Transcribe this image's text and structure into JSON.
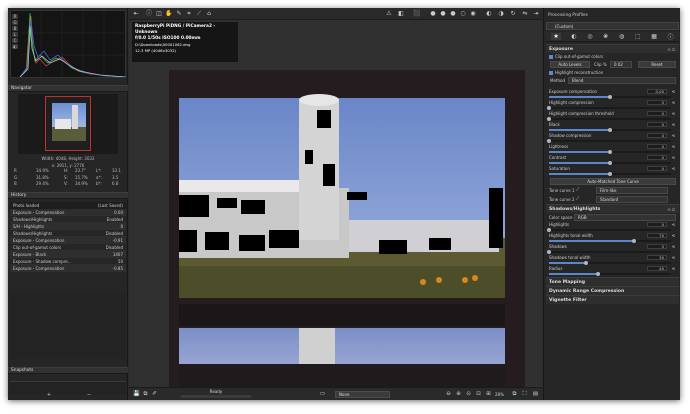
{
  "navigator": {
    "title": "Navigator",
    "size": "Width: 4048, Height: 3032",
    "coords": "x: 2911, y: 2776",
    "readouts": [
      [
        "R",
        "34.9%",
        "H:",
        "23.7°",
        "L*:",
        "33.1"
      ],
      [
        "G",
        "31.8%",
        "S:",
        "15.7%",
        "a*:",
        "3.5"
      ],
      [
        "B",
        "29.4%",
        "V:",
        "34.9%",
        "b*:",
        "6.8"
      ]
    ]
  },
  "history": {
    "title": "History",
    "col1": "Photo loaded",
    "col2": "(Last Saved)",
    "rows": [
      [
        "Exposure - Compensation",
        "0.00"
      ],
      [
        "Shadows/Highlights",
        "Enabled"
      ],
      [
        "S/H - Highlights",
        "0"
      ],
      [
        "Shadows/Highlights",
        "Disabled"
      ],
      [
        "Exposure - Compensation",
        "-0.91"
      ],
      [
        "Clip out-of-gamut colors",
        "Disabled"
      ],
      [
        "Exposure - Black",
        "1407"
      ],
      [
        "Exposure - Shadow compre...",
        "50"
      ],
      [
        "Exposure - Compensation",
        "-0.85"
      ]
    ]
  },
  "snapshots": {
    "title": "Snapshots"
  },
  "image_info": {
    "camera": "RaspberryPi PiDNG / PiCamera2 - Unknown",
    "exposure": "f/0.0  1/50s  ISO100  0.00mm",
    "path": "D:\\Downloads\\00001062.dng",
    "size": "12.3 MP (4048x3032)"
  },
  "status": {
    "ready": "Ready",
    "view_select": "None",
    "zoom": "28%"
  },
  "right": {
    "processing_profiles": "Processing Profiles",
    "profile_value": "(Custom)",
    "exposure": {
      "title": "Exposure",
      "clip": "Clip out-of-gamut colors",
      "auto_levels": "Auto Levels",
      "clip_label": "Clip %",
      "clip_value": "0.02",
      "reset": "Reset",
      "highlight_reconstruction": "Highlight reconstruction",
      "method_label": "Method",
      "method_value": "Blend",
      "sliders": [
        {
          "label": "Exposure compensation",
          "value": "0.00",
          "pos": 0.5
        },
        {
          "label": "Highlight compression",
          "value": "0",
          "pos": 0.0
        },
        {
          "label": "Highlight compression threshold",
          "value": "0",
          "pos": 0.0
        },
        {
          "label": "Black",
          "value": "0",
          "pos": 0.5
        },
        {
          "label": "Shadow compression",
          "value": "0",
          "pos": 0.0
        },
        {
          "label": "Lightness",
          "value": "0",
          "pos": 0.5
        },
        {
          "label": "Contrast",
          "value": "0",
          "pos": 0.5
        },
        {
          "label": "Saturation",
          "value": "0",
          "pos": 0.5
        }
      ],
      "auto_tone": "Auto-Matched Tone Curve",
      "tc1_label": "Tone curve 1",
      "tc1_value": "Film-like",
      "tc2_label": "Tone curve 2",
      "tc2_value": "Standard"
    },
    "shadows": {
      "title": "Shadows/Highlights",
      "color_space_label": "Color space",
      "color_space_value": "RGB",
      "sliders": [
        {
          "label": "Highlights",
          "value": "0",
          "pos": 0.0
        },
        {
          "label": "Highlights tonal width",
          "value": "70",
          "pos": 0.7
        },
        {
          "label": "Shadows",
          "value": "0",
          "pos": 0.0
        },
        {
          "label": "Shadows tonal width",
          "value": "30",
          "pos": 0.3
        },
        {
          "label": "Radius",
          "value": "40",
          "pos": 0.4
        }
      ]
    },
    "folded": [
      "Tone Mapping",
      "Dynamic Range Compression",
      "Vignette Filter"
    ]
  }
}
